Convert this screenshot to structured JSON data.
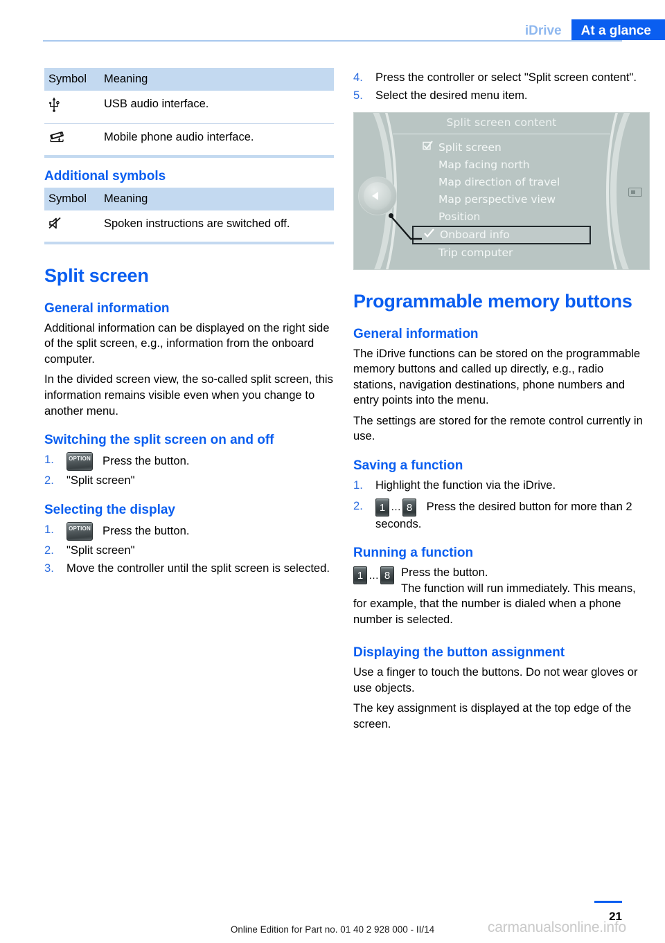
{
  "header": {
    "chapter": "iDrive",
    "section": "At a glance"
  },
  "left": {
    "table1": {
      "headers": [
        "Symbol",
        "Meaning"
      ],
      "rows": [
        {
          "icon": "usb-icon",
          "glyph": "⑂",
          "meaning": "USB audio interface."
        },
        {
          "icon": "snap-in-adapter-icon",
          "glyph": "⌗",
          "meaning": "Mobile phone audio interface."
        }
      ]
    },
    "additional_symbols_heading": "Additional symbols",
    "table2": {
      "headers": [
        "Symbol",
        "Meaning"
      ],
      "rows": [
        {
          "icon": "speaker-muted-icon",
          "glyph": "ὐ7",
          "meaning": "Spoken instructions are switched off."
        }
      ]
    },
    "split_screen": {
      "title": "Split screen",
      "general_information_heading": "General information",
      "paragraphs": [
        "Additional information can be displayed on the right side of the split screen, e.g., information from the onboard computer.",
        "In the divided screen view, the so-called split screen, this information remains visible even when you change to another menu."
      ],
      "switching_heading": "Switching the split screen on and off",
      "switching_steps": [
        {
          "num": "1.",
          "icon_label": "OPTION",
          "text": "Press the button."
        },
        {
          "num": "2.",
          "text": "\"Split screen\""
        }
      ],
      "selecting_heading": "Selecting the display",
      "selecting_steps": [
        {
          "num": "1.",
          "icon_label": "OPTION",
          "text": "Press the button."
        },
        {
          "num": "2.",
          "text": "\"Split screen\""
        },
        {
          "num": "3.",
          "text": "Move the controller until the split screen is selected."
        }
      ]
    }
  },
  "right": {
    "top_steps": [
      {
        "num": "4.",
        "text": "Press the controller or select \"Split screen content\"."
      },
      {
        "num": "5.",
        "text": "Select the desired menu item."
      }
    ],
    "figure": {
      "title": "Split screen content",
      "items": [
        {
          "label": "Split screen",
          "mark": "checkbox-checked"
        },
        {
          "label": "Map facing north",
          "mark": "none"
        },
        {
          "label": "Map direction of travel",
          "mark": "none"
        },
        {
          "label": "Map perspective view",
          "mark": "none"
        },
        {
          "label": "Position",
          "mark": "none"
        },
        {
          "label": "Onboard info",
          "mark": "check",
          "selected": true
        },
        {
          "label": "Trip computer",
          "mark": "none"
        }
      ]
    },
    "memory_buttons": {
      "title": "Programmable memory buttons",
      "general_information_heading": "General information",
      "paragraphs": [
        "The iDrive functions can be stored on the programmable memory buttons and called up directly, e.g., radio stations, navigation destinations, phone numbers and entry points into the menu.",
        "The settings are stored for the remote control currently in use."
      ],
      "saving_heading": "Saving a function",
      "saving_steps": [
        {
          "num": "1.",
          "text": "Highlight the function via the iDrive."
        },
        {
          "num": "2.",
          "btn_first": "1",
          "btn_last": "8",
          "ellipsis": "…",
          "text": "Press the desired button for more than 2 seconds."
        }
      ],
      "running_heading": "Running a function",
      "running": {
        "btn_first": "1",
        "btn_last": "8",
        "ellipsis": "…",
        "line1": "Press the button.",
        "line2": "The function will run immediately. This means, for example, that the number is dialed when a phone number is selected."
      },
      "assignment_heading": "Displaying the button assignment",
      "assignment_paragraphs": [
        "Use a finger to touch the buttons. Do not wear gloves or use objects.",
        "The key assignment is displayed at the top edge of the screen."
      ]
    }
  },
  "footer": {
    "edition": "Online Edition for Part no. 01 40 2 928 000 - II/14",
    "page": "21",
    "watermark": "carmanualsonline.info"
  },
  "colors": {
    "accent_blue": "#0a5ef0",
    "table_header": "#c3d9f0",
    "chapter_blue": "#8fb8ef"
  }
}
